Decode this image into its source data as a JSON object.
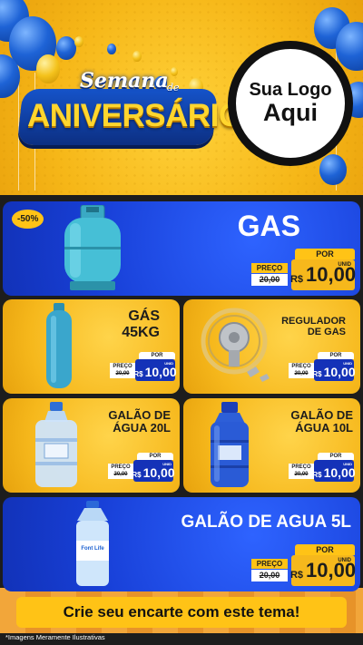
{
  "header": {
    "title_top": "Semana",
    "title_de": "de",
    "title_main": "ANIVERSÁRIO",
    "logo_line1": "Sua Logo",
    "logo_line2": "Aqui"
  },
  "products": [
    {
      "id": "gas",
      "name": "GAS",
      "discount": "-50%",
      "por": "POR",
      "preco": "PREÇO",
      "old": "20,00",
      "currency": "R$",
      "price": "10,00",
      "unit": "UNID"
    },
    {
      "id": "gas45",
      "name": "GÁS\n45KG",
      "por": "POR",
      "preco": "PREÇO",
      "old": "20,00",
      "currency": "R$",
      "price": "10,00",
      "unit": "UNID"
    },
    {
      "id": "regulador",
      "name": "REGULADOR\nDE GAS",
      "por": "POR",
      "preco": "PREÇO",
      "old": "20,00",
      "currency": "R$",
      "price": "10,00",
      "unit": "UNID"
    },
    {
      "id": "galao20",
      "name": "GALÃO DE\nÁGUA 20L",
      "por": "POR",
      "preco": "PREÇO",
      "old": "20,00",
      "currency": "R$",
      "price": "10,00",
      "unit": "UNID"
    },
    {
      "id": "galao10",
      "name": "GALÃO DE\nÁGUA 10L",
      "por": "POR",
      "preco": "PREÇO",
      "old": "20,00",
      "currency": "R$",
      "price": "10,00",
      "unit": "UNID"
    },
    {
      "id": "galao5",
      "name": "GALÃO DE AGUA 5L",
      "por": "POR",
      "preco": "PREÇO",
      "old": "20,00",
      "currency": "R$",
      "price": "10,00",
      "unit": "UNID",
      "bottle_label": "Font Life"
    }
  ],
  "banner": "Crie seu encarte com este tema!",
  "footnote": "*Imagens Meramente Ilustrativas",
  "colors": {
    "blue": "#1840d8",
    "yellow": "#f6b81c",
    "dark": "#1d1d1d"
  }
}
